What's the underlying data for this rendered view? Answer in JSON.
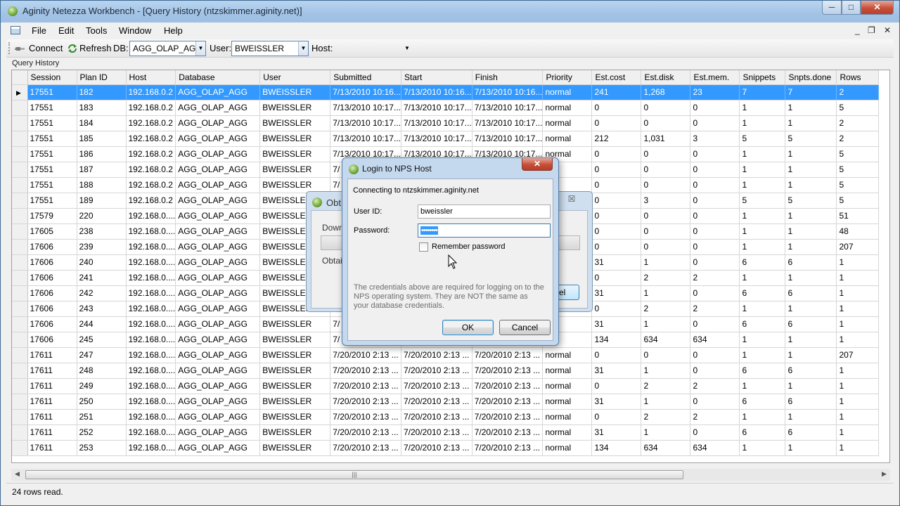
{
  "window": {
    "title": "Aginity Netezza Workbench - [Query History (ntzskimmer.aginity.net)]"
  },
  "menu": [
    "File",
    "Edit",
    "Tools",
    "Window",
    "Help"
  ],
  "mdi_controls": [
    "_",
    "❐",
    "✕"
  ],
  "toolbar": {
    "connect_label": "Connect",
    "refresh_label": "Refresh",
    "db_label": "DB:",
    "db_value": "AGG_OLAP_AGG",
    "user_label": "User:",
    "user_value": "BWEISSLER",
    "host_label": "Host:",
    "host_value": ""
  },
  "panel_title": "Query History",
  "grid": {
    "columns": [
      "Session",
      "Plan ID",
      "Host",
      "Database",
      "User",
      "Submitted",
      "Start",
      "Finish",
      "Priority",
      "Est.cost",
      "Est.disk",
      "Est.mem.",
      "Snippets",
      "Snpts.done",
      "Rows"
    ],
    "rows": [
      [
        "17551",
        "182",
        "192.168.0.2",
        "AGG_OLAP_AGG",
        "BWEISSLER",
        "7/13/2010 10:16...",
        "7/13/2010 10:16...",
        "7/13/2010 10:16...",
        "normal",
        "241",
        "1,268",
        "23",
        "7",
        "7",
        "2"
      ],
      [
        "17551",
        "183",
        "192.168.0.2",
        "AGG_OLAP_AGG",
        "BWEISSLER",
        "7/13/2010 10:17...",
        "7/13/2010 10:17...",
        "7/13/2010 10:17...",
        "normal",
        "0",
        "0",
        "0",
        "1",
        "1",
        "5"
      ],
      [
        "17551",
        "184",
        "192.168.0.2",
        "AGG_OLAP_AGG",
        "BWEISSLER",
        "7/13/2010 10:17...",
        "7/13/2010 10:17...",
        "7/13/2010 10:17...",
        "normal",
        "0",
        "0",
        "0",
        "1",
        "1",
        "2"
      ],
      [
        "17551",
        "185",
        "192.168.0.2",
        "AGG_OLAP_AGG",
        "BWEISSLER",
        "7/13/2010 10:17...",
        "7/13/2010 10:17...",
        "7/13/2010 10:17...",
        "normal",
        "212",
        "1,031",
        "3",
        "5",
        "5",
        "2"
      ],
      [
        "17551",
        "186",
        "192.168.0.2",
        "AGG_OLAP_AGG",
        "BWEISSLER",
        "7/13/2010 10:17...",
        "7/13/2010 10:17...",
        "7/13/2010 10:17...",
        "normal",
        "0",
        "0",
        "0",
        "1",
        "1",
        "5"
      ],
      [
        "17551",
        "187",
        "192.168.0.2",
        "AGG_OLAP_AGG",
        "BWEISSLER",
        "7/",
        "",
        "",
        "",
        "0",
        "0",
        "0",
        "1",
        "1",
        "5"
      ],
      [
        "17551",
        "188",
        "192.168.0.2",
        "AGG_OLAP_AGG",
        "BWEISSLER",
        "7/",
        "",
        "",
        "",
        "0",
        "0",
        "0",
        "1",
        "1",
        "5"
      ],
      [
        "17551",
        "189",
        "192.168.0.2",
        "AGG_OLAP_AGG",
        "BWEISSLER",
        "",
        "",
        "",
        "",
        "0",
        "3",
        "0",
        "5",
        "5",
        "5"
      ],
      [
        "17579",
        "220",
        "192.168.0....",
        "AGG_OLAP_AGG",
        "BWEISSLER",
        "",
        "",
        "",
        "",
        "0",
        "0",
        "0",
        "1",
        "1",
        "51"
      ],
      [
        "17605",
        "238",
        "192.168.0....",
        "AGG_OLAP_AGG",
        "BWEISSLER",
        "",
        "",
        "",
        "",
        "0",
        "0",
        "0",
        "1",
        "1",
        "48"
      ],
      [
        "17606",
        "239",
        "192.168.0....",
        "AGG_OLAP_AGG",
        "BWEISSLER",
        "",
        "",
        "",
        "",
        "0",
        "0",
        "0",
        "1",
        "1",
        "207"
      ],
      [
        "17606",
        "240",
        "192.168.0....",
        "AGG_OLAP_AGG",
        "BWEISSLER",
        "",
        "",
        "",
        "",
        "31",
        "1",
        "0",
        "6",
        "6",
        "1"
      ],
      [
        "17606",
        "241",
        "192.168.0....",
        "AGG_OLAP_AGG",
        "BWEISSLER",
        "",
        "",
        "",
        "",
        "0",
        "2",
        "2",
        "1",
        "1",
        "1"
      ],
      [
        "17606",
        "242",
        "192.168.0....",
        "AGG_OLAP_AGG",
        "BWEISSLER",
        "",
        "",
        "",
        "",
        "31",
        "1",
        "0",
        "6",
        "6",
        "1"
      ],
      [
        "17606",
        "243",
        "192.168.0....",
        "AGG_OLAP_AGG",
        "BWEISSLER",
        "",
        "",
        "",
        "",
        "0",
        "2",
        "2",
        "1",
        "1",
        "1"
      ],
      [
        "17606",
        "244",
        "192.168.0....",
        "AGG_OLAP_AGG",
        "BWEISSLER",
        "7/",
        "",
        "",
        "",
        "31",
        "1",
        "0",
        "6",
        "6",
        "1"
      ],
      [
        "17606",
        "245",
        "192.168.0....",
        "AGG_OLAP_AGG",
        "BWEISSLER",
        "7/",
        "",
        "",
        "",
        "134",
        "634",
        "634",
        "1",
        "1",
        "1"
      ],
      [
        "17611",
        "247",
        "192.168.0....",
        "AGG_OLAP_AGG",
        "BWEISSLER",
        "7/20/2010 2:13 ...",
        "7/20/2010 2:13 ...",
        "7/20/2010 2:13 ...",
        "normal",
        "0",
        "0",
        "0",
        "1",
        "1",
        "207"
      ],
      [
        "17611",
        "248",
        "192.168.0....",
        "AGG_OLAP_AGG",
        "BWEISSLER",
        "7/20/2010 2:13 ...",
        "7/20/2010 2:13 ...",
        "7/20/2010 2:13 ...",
        "normal",
        "31",
        "1",
        "0",
        "6",
        "6",
        "1"
      ],
      [
        "17611",
        "249",
        "192.168.0....",
        "AGG_OLAP_AGG",
        "BWEISSLER",
        "7/20/2010 2:13 ...",
        "7/20/2010 2:13 ...",
        "7/20/2010 2:13 ...",
        "normal",
        "0",
        "2",
        "2",
        "1",
        "1",
        "1"
      ],
      [
        "17611",
        "250",
        "192.168.0....",
        "AGG_OLAP_AGG",
        "BWEISSLER",
        "7/20/2010 2:13 ...",
        "7/20/2010 2:13 ...",
        "7/20/2010 2:13 ...",
        "normal",
        "31",
        "1",
        "0",
        "6",
        "6",
        "1"
      ],
      [
        "17611",
        "251",
        "192.168.0....",
        "AGG_OLAP_AGG",
        "BWEISSLER",
        "7/20/2010 2:13 ...",
        "7/20/2010 2:13 ...",
        "7/20/2010 2:13 ...",
        "normal",
        "0",
        "2",
        "2",
        "1",
        "1",
        "1"
      ],
      [
        "17611",
        "252",
        "192.168.0....",
        "AGG_OLAP_AGG",
        "BWEISSLER",
        "7/20/2010 2:13 ...",
        "7/20/2010 2:13 ...",
        "7/20/2010 2:13 ...",
        "normal",
        "31",
        "1",
        "0",
        "6",
        "6",
        "1"
      ],
      [
        "17611",
        "253",
        "192.168.0....",
        "AGG_OLAP_AGG",
        "BWEISSLER",
        "7/20/2010 2:13 ...",
        "7/20/2010 2:13 ...",
        "7/20/2010 2:13 ...",
        "normal",
        "134",
        "634",
        "634",
        "1",
        "1",
        "1"
      ]
    ]
  },
  "status_text": "24 rows read.",
  "bg_dialog": {
    "title": "Obt",
    "label1": "Down",
    "label2": "Obtai",
    "button": "el"
  },
  "login": {
    "title": "Login to NPS Host",
    "connecting": "Connecting to ntzskimmer.aginity.net",
    "user_id_label": "User ID:",
    "user_id_value": "bweissler",
    "password_label": "Password:",
    "password_mask": "••••••••",
    "remember_label": "Remember password",
    "note": "The credentials above are required for logging on to the NPS operating system. They are NOT the same as your database credentials.",
    "ok_label": "OK",
    "cancel_label": "Cancel"
  }
}
